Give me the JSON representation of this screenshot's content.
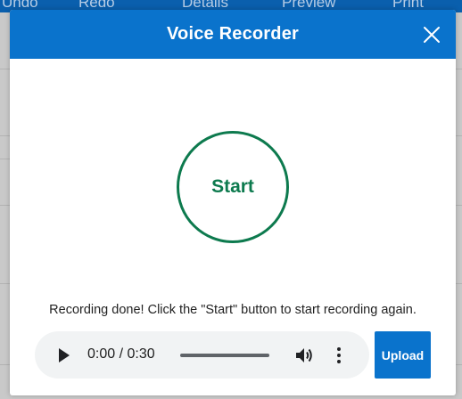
{
  "background": {
    "toolbar": {
      "undo_label": "Undo",
      "redo_label": "Redo",
      "details_label": "Details",
      "preview_label": "Preview",
      "print_label": "Print"
    }
  },
  "dialog": {
    "title": "Voice Recorder",
    "close_icon": "close-icon",
    "start_label": "Start",
    "status_message": "Recording done! Click the \"Start\" button to start recording again.",
    "player": {
      "time_display": "0:00 / 0:30",
      "progress_fraction": 0.0,
      "icons": [
        "play-icon",
        "volume-icon",
        "more-vert-icon"
      ]
    },
    "upload_label": "Upload"
  },
  "colors": {
    "header_blue": "#0a73cc",
    "start_green": "#0d7a4e",
    "player_bg": "#f1f3f4"
  }
}
